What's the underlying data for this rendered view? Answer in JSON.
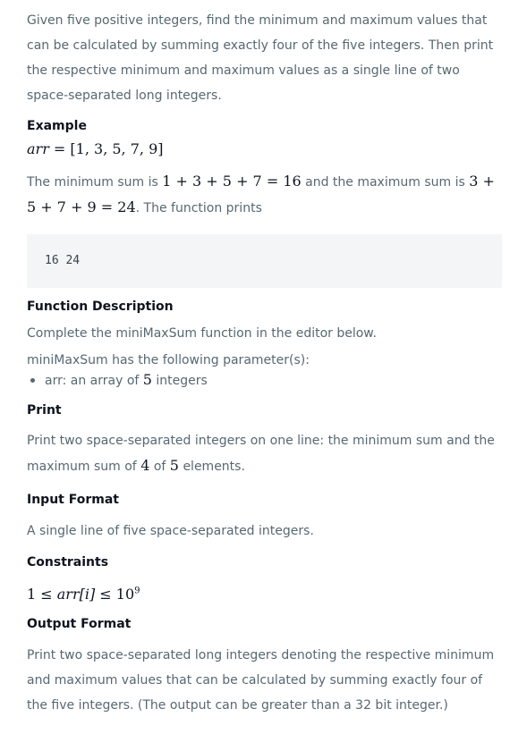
{
  "intro": "Given five positive integers, find the minimum and maximum values that can be calculated by summing exactly four of the five integers. Then print the respective minimum and maximum values as a single line of two space-separated long integers.",
  "example": {
    "title": "Example",
    "arr_label": "arr",
    "arr_value": "[1, 3, 5, 7, 9]",
    "text_before": "The minimum sum is",
    "min_expr": "1 + 3 + 5 + 7 = 16",
    "text_middle": "and the maximum sum is",
    "max_expr": "3 + 5 + 7 + 9 = 24",
    "text_after": ". The function prints",
    "output": "16 24"
  },
  "function_description": {
    "title": "Function Description",
    "text": "Complete the miniMaxSum function in the editor below.",
    "params_intro": "miniMaxSum has the following parameter(s):",
    "param_prefix": "arr: an array of",
    "param_count": "5",
    "param_suffix": "integers"
  },
  "print": {
    "title": "Print",
    "text_1": "Print two space-separated integers on one line: the minimum sum and the maximum sum of",
    "n1": "4",
    "text_2": "of",
    "n2": "5",
    "text_3": "elements."
  },
  "input_format": {
    "title": "Input Format",
    "text": "A single line of five space-separated integers."
  },
  "constraints": {
    "title": "Constraints",
    "lhs": "1 ≤",
    "var": "arr[i]",
    "rhs": "≤ 10",
    "exp": "9"
  },
  "output_format": {
    "title": "Output Format",
    "text": "Print two space-separated long integers denoting the respective minimum and maximum values that can be calculated by summing exactly four of the five integers. (The output can be greater than a 32 bit integer.)"
  }
}
